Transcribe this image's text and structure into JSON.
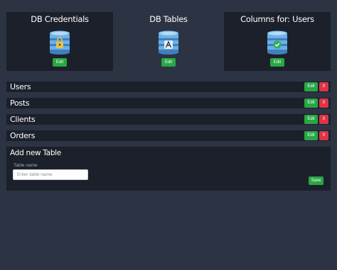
{
  "cards": [
    {
      "title": "DB Credentials",
      "icon": "database-lock-icon",
      "edit_label": "Edit"
    },
    {
      "title": "DB Tables",
      "icon": "database-table-icon",
      "edit_label": "Edit"
    },
    {
      "title": "Columns for: Users",
      "icon": "database-check-icon",
      "edit_label": "Edit"
    }
  ],
  "tables": [
    {
      "name": "Users",
      "edit_label": "Edit",
      "delete_label": "X"
    },
    {
      "name": "Posts",
      "edit_label": "Edit",
      "delete_label": "X"
    },
    {
      "name": "Clients",
      "edit_label": "Edit",
      "delete_label": "X"
    },
    {
      "name": "Orders",
      "edit_label": "Edit",
      "delete_label": "X"
    }
  ],
  "add_table": {
    "title": "Add new Table",
    "field_label": "Table name",
    "placeholder": "Enter table name",
    "value": "",
    "save_label": "Save"
  },
  "colors": {
    "background": "#2c3342",
    "panel": "#1b202b",
    "success": "#28a745",
    "danger": "#dc3545",
    "db_blue": "#5aa0d8"
  }
}
